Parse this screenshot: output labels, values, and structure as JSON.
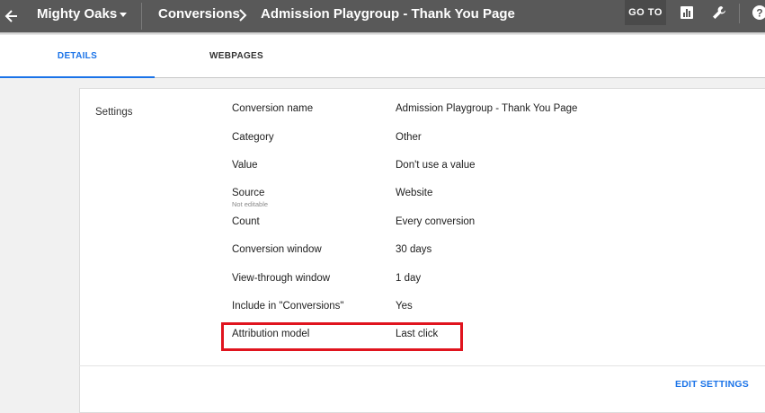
{
  "header": {
    "account_name": "Mighty Oaks",
    "breadcrumb_section": "Conversions",
    "breadcrumb_page": "Admission Playgroup - Thank You Page",
    "goto_label": "GO TO"
  },
  "tabs": [
    {
      "label": "DETAILS",
      "active": true
    },
    {
      "label": "WEBPAGES",
      "active": false
    }
  ],
  "settings": {
    "section_label": "Settings",
    "rows": [
      {
        "label": "Conversion name",
        "value": "Admission Playgroup - Thank You Page"
      },
      {
        "label": "Category",
        "value": "Other"
      },
      {
        "label": "Value",
        "value": "Don't use a value"
      },
      {
        "label": "Source",
        "value": "Website",
        "note": "Not editable"
      },
      {
        "label": "Count",
        "value": "Every conversion"
      },
      {
        "label": "Conversion window",
        "value": "30 days"
      },
      {
        "label": "View-through window",
        "value": "1 day"
      },
      {
        "label": "Include in \"Conversions\"",
        "value": "Yes"
      },
      {
        "label": "Attribution model",
        "value": "Last click",
        "highlighted": true
      }
    ],
    "edit_label": "EDIT SETTINGS"
  },
  "colors": {
    "topbar": "#595959",
    "accent": "#1a73e8",
    "highlight": "#e0141e"
  },
  "icons": [
    "back-arrow-icon",
    "caret-down-icon",
    "chevron-right-icon",
    "reports-icon",
    "wrench-icon",
    "help-icon"
  ]
}
